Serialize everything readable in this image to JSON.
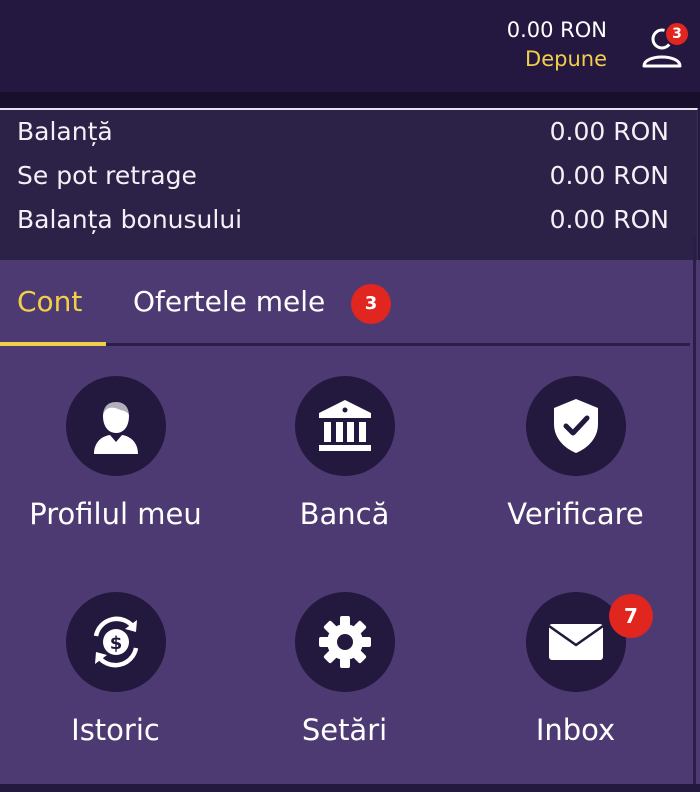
{
  "header": {
    "amount": "0.00 RON",
    "deposit_label": "Depune",
    "notification_count": "3"
  },
  "balances": [
    {
      "label": "Balanță",
      "value": "0.00 RON"
    },
    {
      "label": "Se pot retrage",
      "value": "0.00 RON"
    },
    {
      "label": "Balanța bonusului",
      "value": "0.00 RON"
    }
  ],
  "tabs": [
    {
      "label": "Cont",
      "active": true
    },
    {
      "label": "Ofertele mele",
      "badge": "3"
    }
  ],
  "menu_items": [
    {
      "label": "Profilul meu",
      "icon": "user-profile-icon"
    },
    {
      "label": "Bancă",
      "icon": "bank-icon"
    },
    {
      "label": "Verificare",
      "icon": "shield-check-icon"
    },
    {
      "label": "Istoric",
      "icon": "history-dollar-icon"
    },
    {
      "label": "Setări",
      "icon": "gear-icon"
    },
    {
      "label": "Inbox",
      "icon": "envelope-icon",
      "badge": "7"
    }
  ],
  "colors": {
    "accent": "#f2cf4a",
    "badge": "#e0261f",
    "menu_bg": "#4d3a72",
    "header_bg": "#241840"
  }
}
